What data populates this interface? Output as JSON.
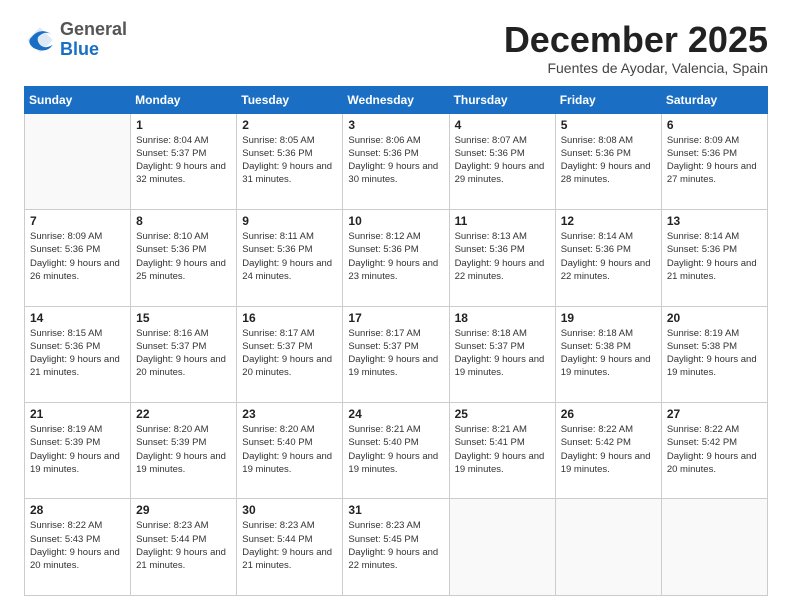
{
  "logo": {
    "general": "General",
    "blue": "Blue"
  },
  "title": "December 2025",
  "subtitle": "Fuentes de Ayodar, Valencia, Spain",
  "weekdays": [
    "Sunday",
    "Monday",
    "Tuesday",
    "Wednesday",
    "Thursday",
    "Friday",
    "Saturday"
  ],
  "weeks": [
    [
      {
        "day": "",
        "info": ""
      },
      {
        "day": "1",
        "info": "Sunrise: 8:04 AM\nSunset: 5:37 PM\nDaylight: 9 hours\nand 32 minutes."
      },
      {
        "day": "2",
        "info": "Sunrise: 8:05 AM\nSunset: 5:36 PM\nDaylight: 9 hours\nand 31 minutes."
      },
      {
        "day": "3",
        "info": "Sunrise: 8:06 AM\nSunset: 5:36 PM\nDaylight: 9 hours\nand 30 minutes."
      },
      {
        "day": "4",
        "info": "Sunrise: 8:07 AM\nSunset: 5:36 PM\nDaylight: 9 hours\nand 29 minutes."
      },
      {
        "day": "5",
        "info": "Sunrise: 8:08 AM\nSunset: 5:36 PM\nDaylight: 9 hours\nand 28 minutes."
      },
      {
        "day": "6",
        "info": "Sunrise: 8:09 AM\nSunset: 5:36 PM\nDaylight: 9 hours\nand 27 minutes."
      }
    ],
    [
      {
        "day": "7",
        "info": "Sunrise: 8:09 AM\nSunset: 5:36 PM\nDaylight: 9 hours\nand 26 minutes."
      },
      {
        "day": "8",
        "info": "Sunrise: 8:10 AM\nSunset: 5:36 PM\nDaylight: 9 hours\nand 25 minutes."
      },
      {
        "day": "9",
        "info": "Sunrise: 8:11 AM\nSunset: 5:36 PM\nDaylight: 9 hours\nand 24 minutes."
      },
      {
        "day": "10",
        "info": "Sunrise: 8:12 AM\nSunset: 5:36 PM\nDaylight: 9 hours\nand 23 minutes."
      },
      {
        "day": "11",
        "info": "Sunrise: 8:13 AM\nSunset: 5:36 PM\nDaylight: 9 hours\nand 22 minutes."
      },
      {
        "day": "12",
        "info": "Sunrise: 8:14 AM\nSunset: 5:36 PM\nDaylight: 9 hours\nand 22 minutes."
      },
      {
        "day": "13",
        "info": "Sunrise: 8:14 AM\nSunset: 5:36 PM\nDaylight: 9 hours\nand 21 minutes."
      }
    ],
    [
      {
        "day": "14",
        "info": "Sunrise: 8:15 AM\nSunset: 5:36 PM\nDaylight: 9 hours\nand 21 minutes."
      },
      {
        "day": "15",
        "info": "Sunrise: 8:16 AM\nSunset: 5:37 PM\nDaylight: 9 hours\nand 20 minutes."
      },
      {
        "day": "16",
        "info": "Sunrise: 8:17 AM\nSunset: 5:37 PM\nDaylight: 9 hours\nand 20 minutes."
      },
      {
        "day": "17",
        "info": "Sunrise: 8:17 AM\nSunset: 5:37 PM\nDaylight: 9 hours\nand 19 minutes."
      },
      {
        "day": "18",
        "info": "Sunrise: 8:18 AM\nSunset: 5:37 PM\nDaylight: 9 hours\nand 19 minutes."
      },
      {
        "day": "19",
        "info": "Sunrise: 8:18 AM\nSunset: 5:38 PM\nDaylight: 9 hours\nand 19 minutes."
      },
      {
        "day": "20",
        "info": "Sunrise: 8:19 AM\nSunset: 5:38 PM\nDaylight: 9 hours\nand 19 minutes."
      }
    ],
    [
      {
        "day": "21",
        "info": "Sunrise: 8:19 AM\nSunset: 5:39 PM\nDaylight: 9 hours\nand 19 minutes."
      },
      {
        "day": "22",
        "info": "Sunrise: 8:20 AM\nSunset: 5:39 PM\nDaylight: 9 hours\nand 19 minutes."
      },
      {
        "day": "23",
        "info": "Sunrise: 8:20 AM\nSunset: 5:40 PM\nDaylight: 9 hours\nand 19 minutes."
      },
      {
        "day": "24",
        "info": "Sunrise: 8:21 AM\nSunset: 5:40 PM\nDaylight: 9 hours\nand 19 minutes."
      },
      {
        "day": "25",
        "info": "Sunrise: 8:21 AM\nSunset: 5:41 PM\nDaylight: 9 hours\nand 19 minutes."
      },
      {
        "day": "26",
        "info": "Sunrise: 8:22 AM\nSunset: 5:42 PM\nDaylight: 9 hours\nand 19 minutes."
      },
      {
        "day": "27",
        "info": "Sunrise: 8:22 AM\nSunset: 5:42 PM\nDaylight: 9 hours\nand 20 minutes."
      }
    ],
    [
      {
        "day": "28",
        "info": "Sunrise: 8:22 AM\nSunset: 5:43 PM\nDaylight: 9 hours\nand 20 minutes."
      },
      {
        "day": "29",
        "info": "Sunrise: 8:23 AM\nSunset: 5:44 PM\nDaylight: 9 hours\nand 21 minutes."
      },
      {
        "day": "30",
        "info": "Sunrise: 8:23 AM\nSunset: 5:44 PM\nDaylight: 9 hours\nand 21 minutes."
      },
      {
        "day": "31",
        "info": "Sunrise: 8:23 AM\nSunset: 5:45 PM\nDaylight: 9 hours\nand 22 minutes."
      },
      {
        "day": "",
        "info": ""
      },
      {
        "day": "",
        "info": ""
      },
      {
        "day": "",
        "info": ""
      }
    ]
  ]
}
